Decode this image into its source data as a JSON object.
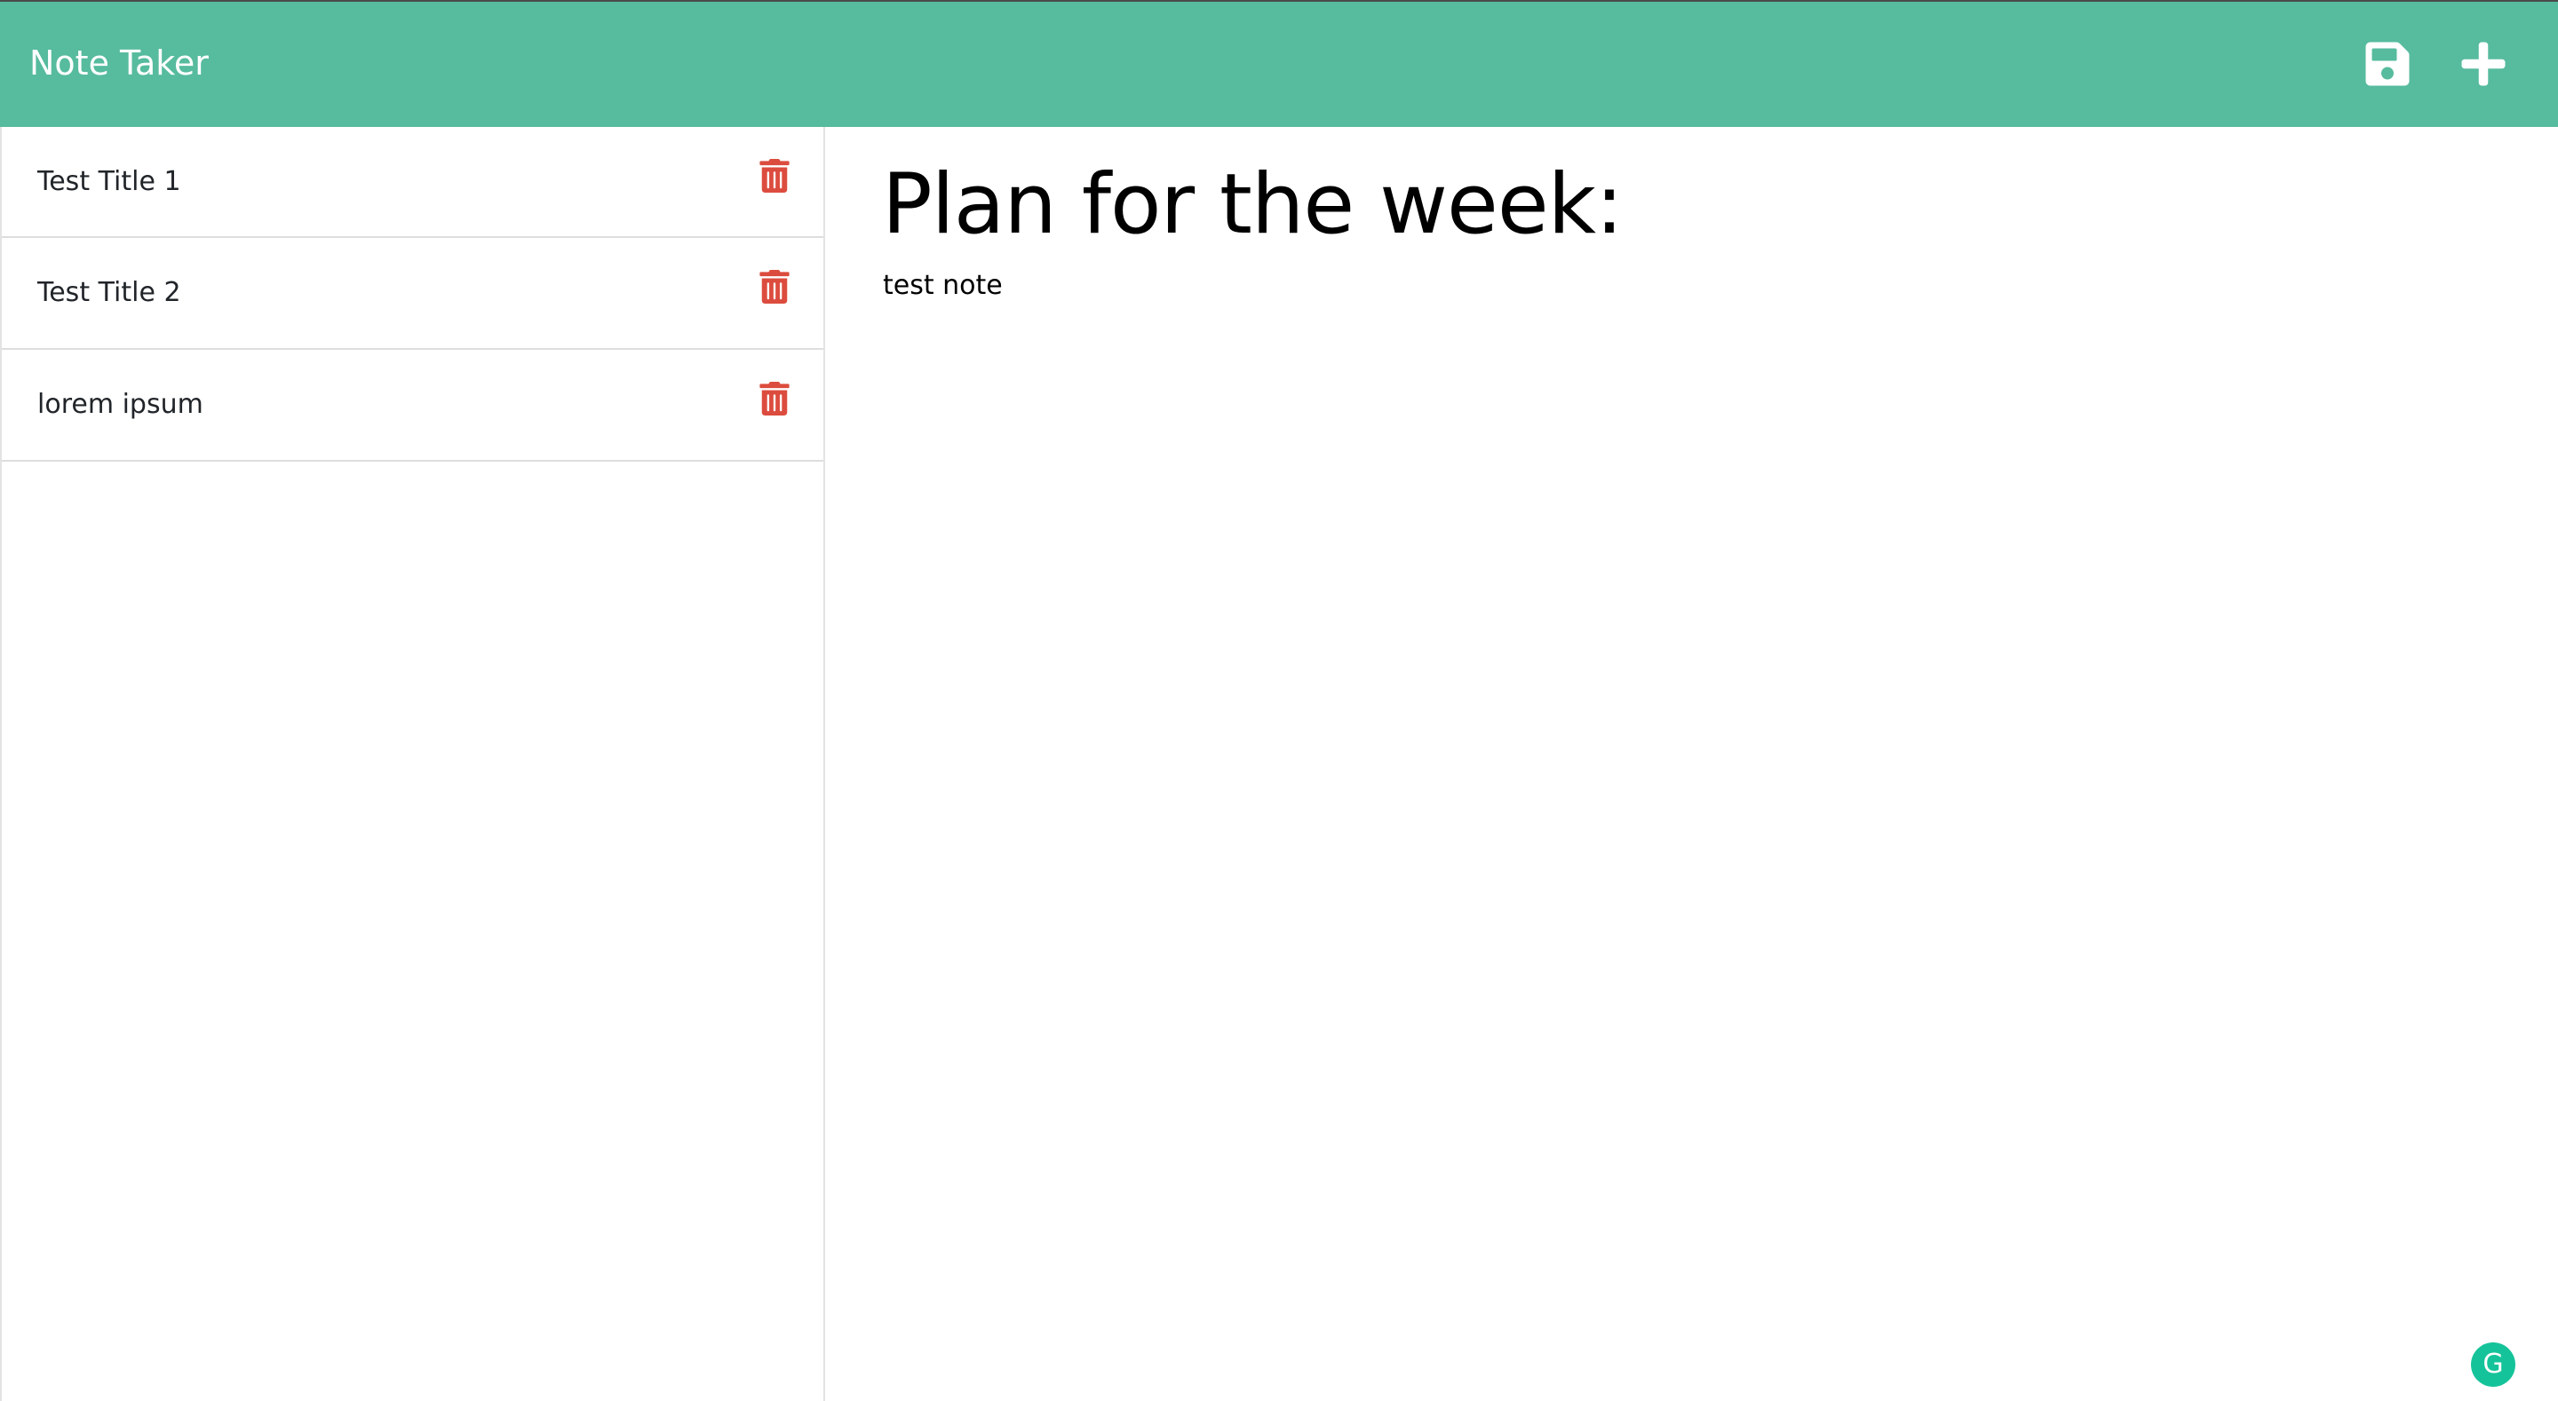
{
  "app": {
    "title": "Note Taker"
  },
  "toolbar": {
    "save_icon": "save-icon",
    "add_icon": "plus-icon"
  },
  "notes": [
    {
      "title": "Test Title 1"
    },
    {
      "title": "Test Title 2"
    },
    {
      "title": "lorem ipsum"
    }
  ],
  "editor": {
    "title_value": "Plan for the week:",
    "body_value": "test note"
  },
  "grammarly": {
    "label": "G"
  },
  "colors": {
    "header": "#57bb9e",
    "delete": "#dc4c3e"
  }
}
